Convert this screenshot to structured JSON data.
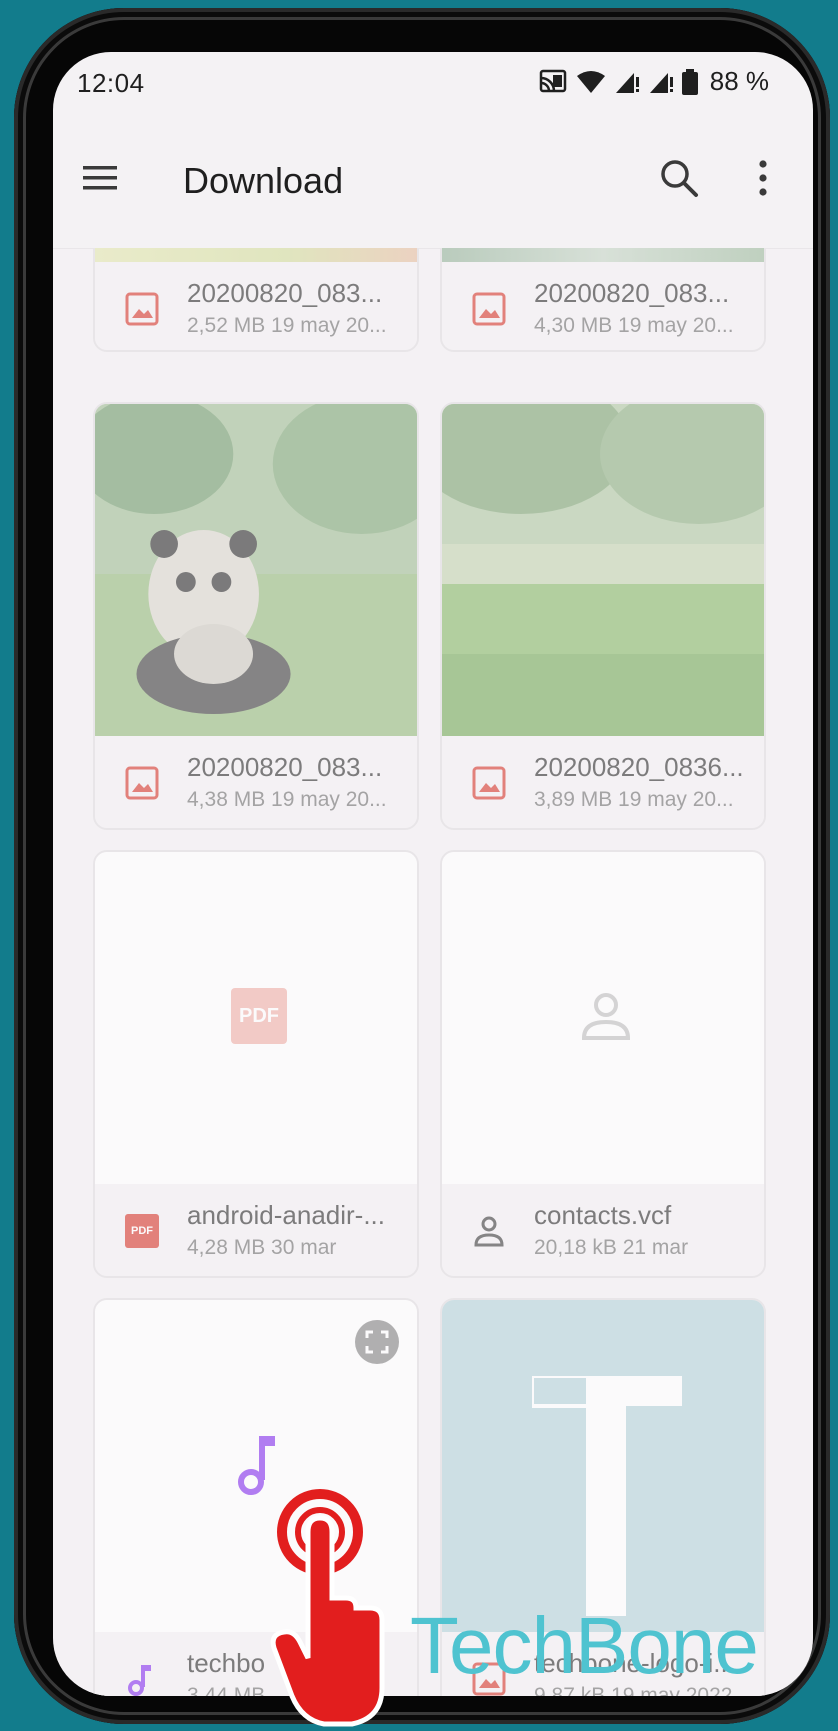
{
  "status": {
    "time": "12:04",
    "battery_text": "88 %",
    "icons": [
      "cast-icon",
      "wifi-icon",
      "signal-icon",
      "signal-roaming-icon",
      "battery-icon"
    ]
  },
  "appbar": {
    "title": "Download",
    "menu_icon": "hamburger-menu-icon",
    "search_icon": "search-icon",
    "more_icon": "more-vert-icon"
  },
  "files": [
    {
      "name": "20200820_083...",
      "meta": "2,52 MB  19 may 20...",
      "type": "image"
    },
    {
      "name": "20200820_083...",
      "meta": "4,30 MB  19 may 20...",
      "type": "image"
    },
    {
      "name": "20200820_083...",
      "meta": "4,38 MB  19 may 20...",
      "type": "image"
    },
    {
      "name": "20200820_0836...",
      "meta": "3,89 MB  19 may 20...",
      "type": "image"
    },
    {
      "name": "android-anadir-...",
      "meta": "4,28 MB  30 mar",
      "type": "pdf",
      "thumb_label": "PDF"
    },
    {
      "name": "contacts.vcf",
      "meta": "20,18 kB  21 mar",
      "type": "contact"
    },
    {
      "name": "techbo",
      "meta": "3,44 MB",
      "type": "audio"
    },
    {
      "name": "techbone-logo-i...",
      "meta": "9,87 kB  19 may 2022",
      "type": "image"
    }
  ],
  "watermark": "TechBone",
  "colors": {
    "background": "#127c8c",
    "screen": "#f4f2f4",
    "image_icon": "#d9453b",
    "pdf_icon": "#d9453b",
    "audio_icon": "#8e3ff0",
    "logo_thumb": "#b9d6dc",
    "hand": "#e21e1e",
    "watermark": "#4fc3d0"
  }
}
